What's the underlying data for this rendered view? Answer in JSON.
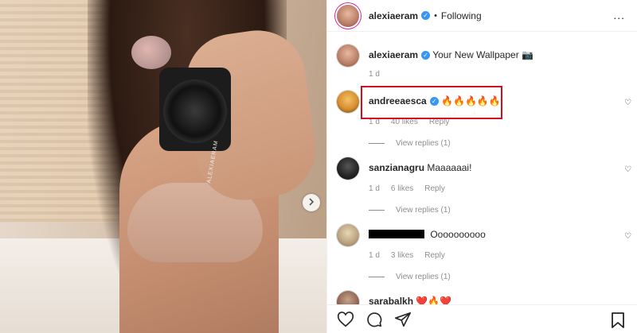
{
  "post": {
    "photo_alt": "Photo",
    "strap_text": "ALEXIAERAM",
    "next_icon": "chevron-right-icon"
  },
  "header": {
    "username": "alexiaeram",
    "dot": "•",
    "following": "Following",
    "more": "..."
  },
  "caption": {
    "username": "alexiaeram",
    "text": "Your New Wallpaper 📷",
    "time": "1 d"
  },
  "comments": [
    {
      "username": "andreeaesca",
      "verified": true,
      "text": "🔥🔥🔥🔥🔥",
      "time": "1 d",
      "likes": "40 likes",
      "reply": "Reply",
      "view_replies": "View replies (1)"
    },
    {
      "username": "sanzianagru",
      "verified": false,
      "text": "Maaaaaai!",
      "time": "1 d",
      "likes": "6 likes",
      "reply": "Reply",
      "view_replies": "View replies (1)"
    },
    {
      "username": "",
      "verified": false,
      "text": "Oooooooooo",
      "time": "1 d",
      "likes": "3 likes",
      "reply": "Reply",
      "view_replies": "View replies (1)"
    },
    {
      "username": "sarabalkh",
      "verified": false,
      "text": "❤️🔥❤️",
      "time": "",
      "likes": "",
      "reply": "",
      "view_replies": ""
    }
  ],
  "colors": {
    "verified": "#3897f0",
    "highlight": "#d10f1f",
    "muted": "#8e8e8e"
  },
  "icons": [
    "heart-icon",
    "comment-icon",
    "share-icon",
    "bookmark-icon",
    "more-icon"
  ]
}
